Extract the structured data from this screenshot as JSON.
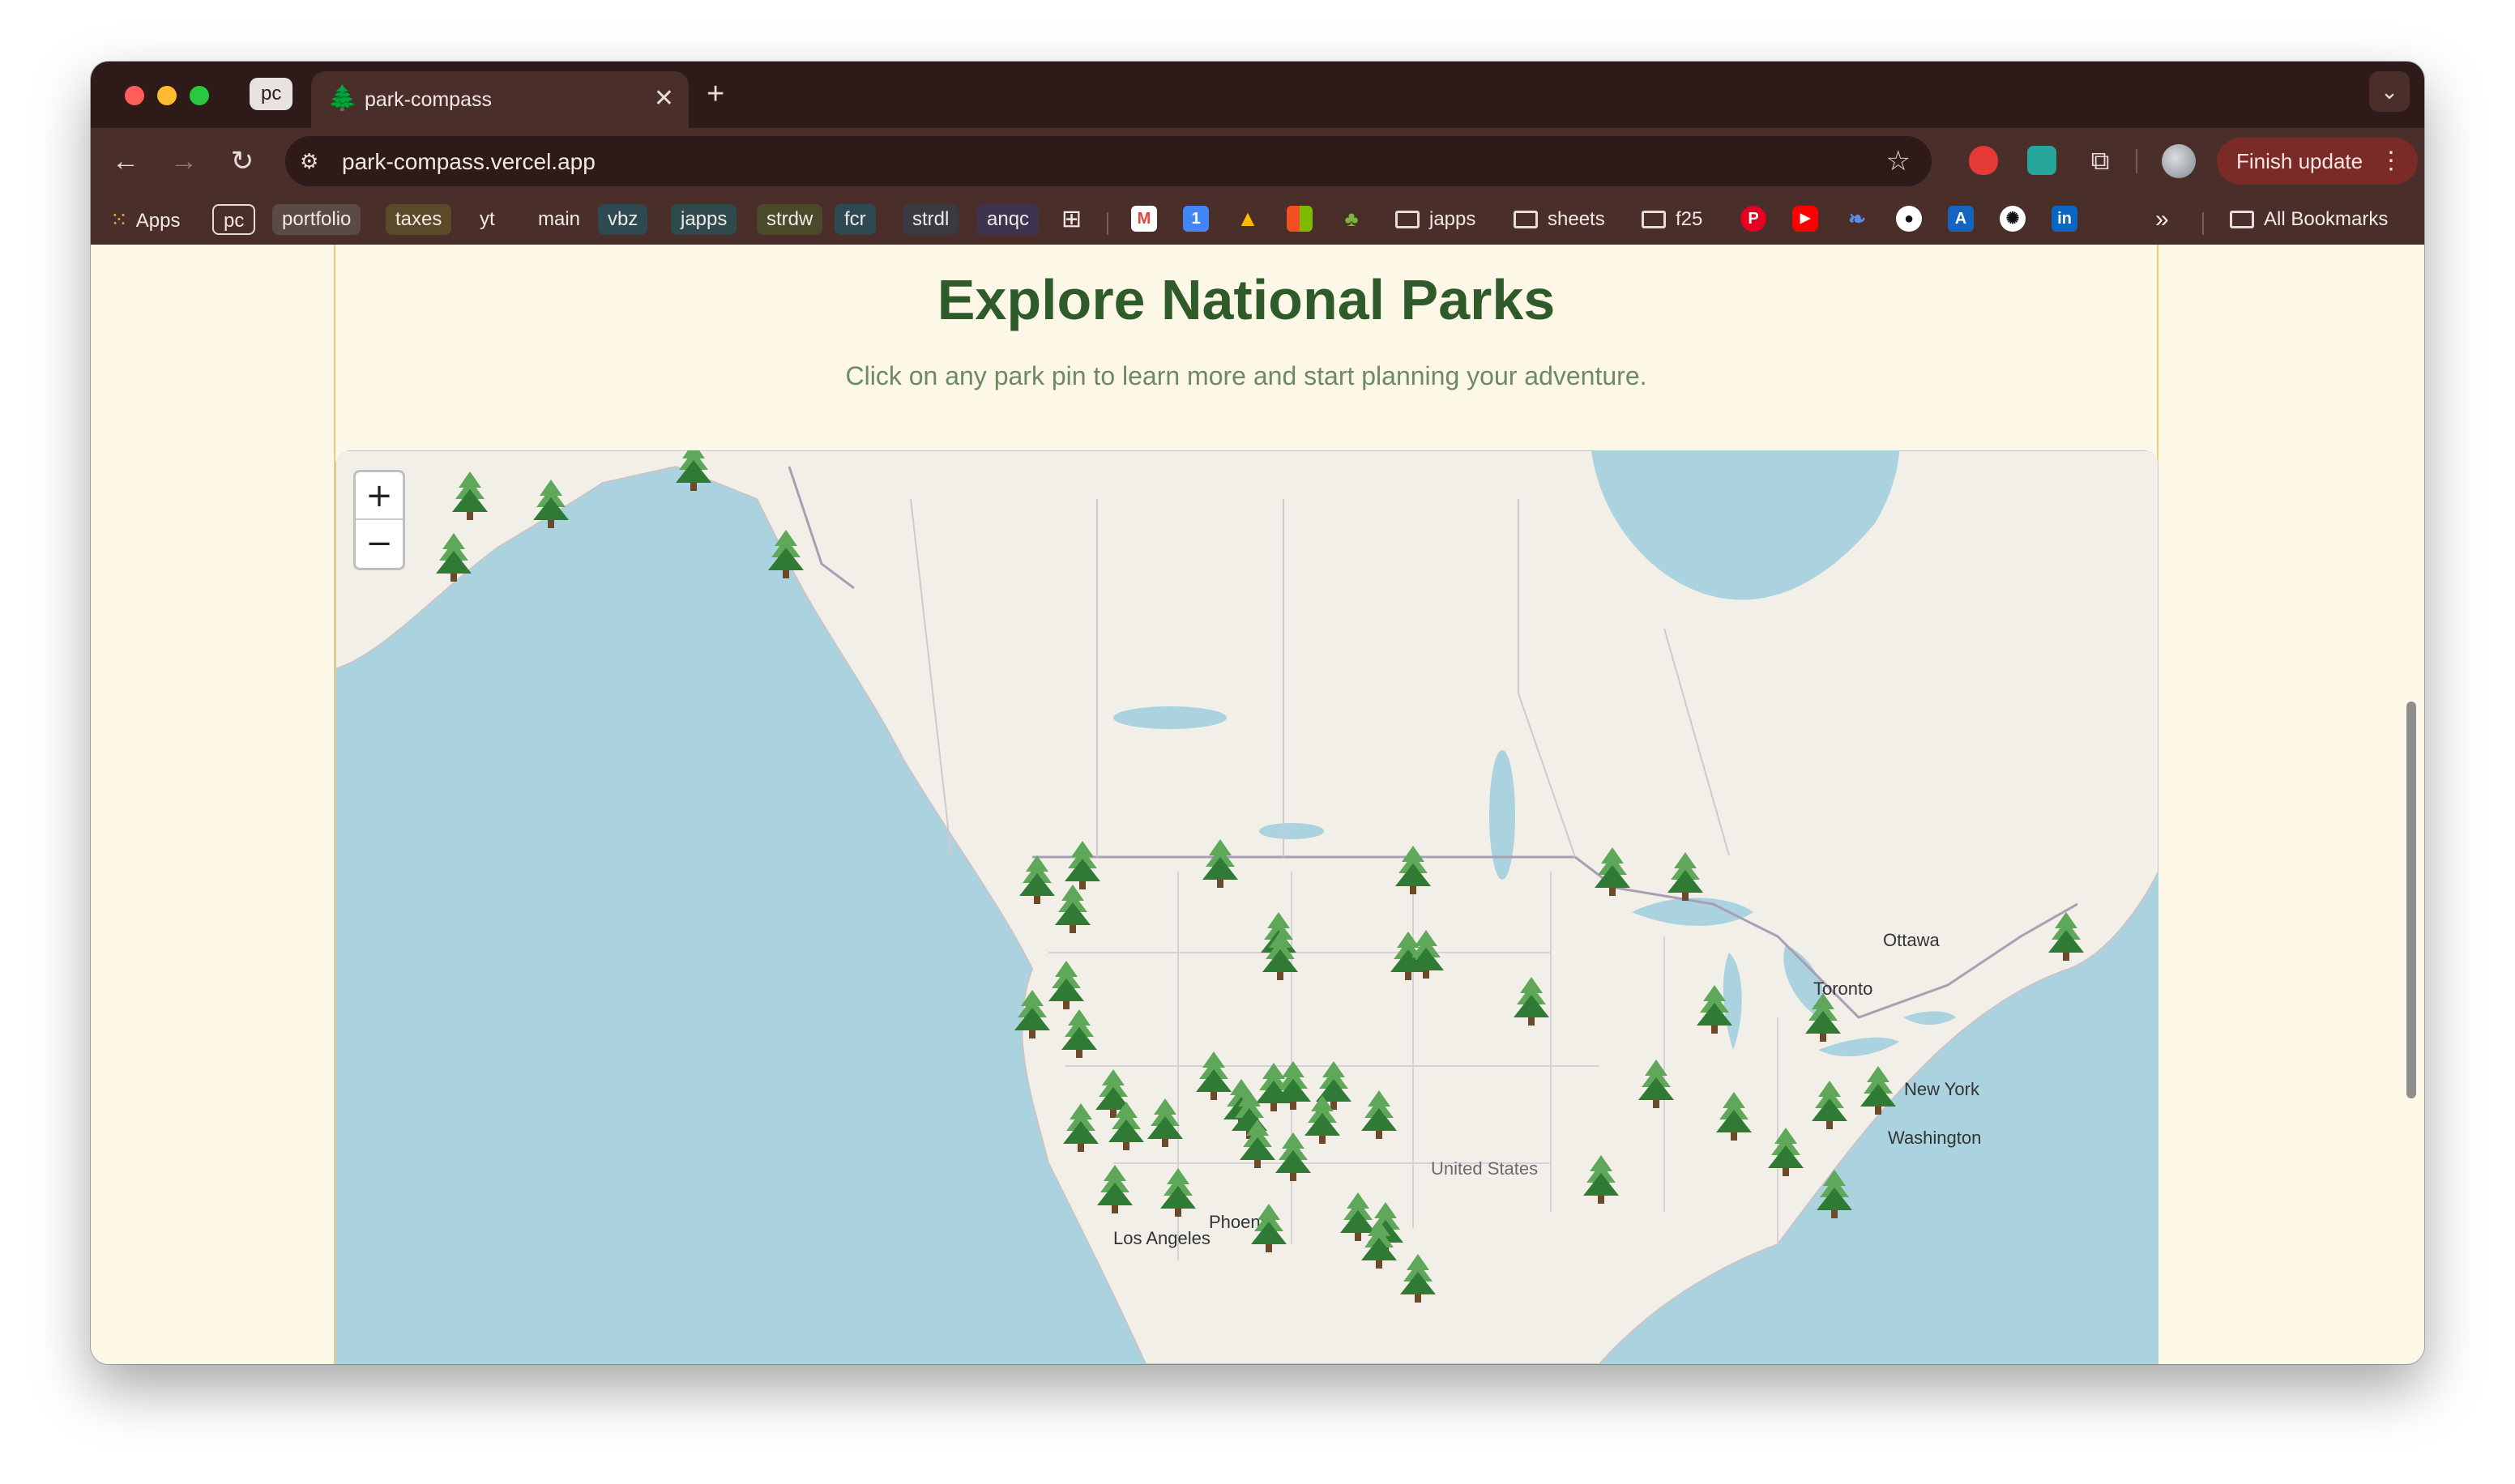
{
  "browser": {
    "tab_group_label": "pc",
    "tab": {
      "title": "park-compass",
      "icon": "evergreen-tree-icon"
    },
    "url": "park-compass.vercel.app",
    "finish_update_label": "Finish update",
    "bookmarks": {
      "apps_label": "Apps",
      "chips": [
        {
          "label": "pc",
          "color": "#2e1a18"
        },
        {
          "label": "portfolio",
          "color": "#5b4a45"
        },
        {
          "label": "taxes",
          "color": "#5a4a2a"
        },
        {
          "label": "yt",
          "color": ""
        },
        {
          "label": "main",
          "color": ""
        },
        {
          "label": "vbz",
          "color": "#2d4a52"
        },
        {
          "label": "japps",
          "color": "#2f4a4d"
        },
        {
          "label": "strdw",
          "color": "#4a4a2a"
        },
        {
          "label": "fcr",
          "color": "#2d4a52"
        },
        {
          "label": "strdl",
          "color": "#3a3a42"
        },
        {
          "label": "anqc",
          "color": "#3e3450"
        }
      ],
      "folders": [
        "japps",
        "sheets",
        "f25"
      ],
      "all_bookmarks_label": "All Bookmarks",
      "overflow_label": "»"
    }
  },
  "page": {
    "title": "Explore National Parks",
    "subtitle": "Click on any park pin to learn more and start planning your adventure."
  },
  "map": {
    "zoom_in_label": "+",
    "zoom_out_label": "−",
    "labels": {
      "united_states": "United States",
      "ottawa": "Ottawa",
      "toronto": "Toronto",
      "new_york": "New York",
      "washington": "Washington",
      "phoenix": "Phoenix",
      "los_angeles": "Los Angeles"
    },
    "pin_icon": "evergreen-tree-icon",
    "colors": {
      "water": "#aad3df",
      "land": "#f2efe9",
      "pin_light": "#5fa85a",
      "pin_dark": "#2f7a34"
    }
  }
}
